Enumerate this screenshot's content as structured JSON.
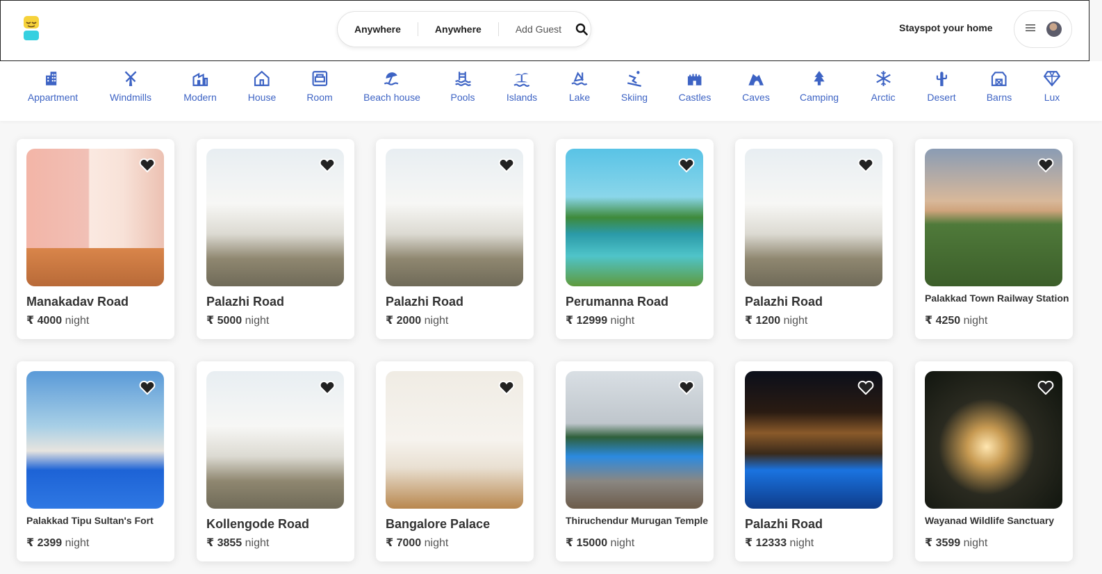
{
  "header": {
    "search": {
      "location": "Anywhere",
      "dates": "Anywhere",
      "guests": "Add Guest"
    },
    "host_link": "Stayspot your home"
  },
  "categories": [
    {
      "label": "Appartment",
      "icon": "apartment-icon"
    },
    {
      "label": "Windmills",
      "icon": "windmill-icon"
    },
    {
      "label": "Modern",
      "icon": "modern-icon"
    },
    {
      "label": "House",
      "icon": "house-icon"
    },
    {
      "label": "Room",
      "icon": "room-icon"
    },
    {
      "label": "Beach house",
      "icon": "beach-icon"
    },
    {
      "label": "Pools",
      "icon": "pool-icon"
    },
    {
      "label": "Islands",
      "icon": "island-icon"
    },
    {
      "label": "Lake",
      "icon": "lake-icon"
    },
    {
      "label": "Skiing",
      "icon": "skiing-icon"
    },
    {
      "label": "Castles",
      "icon": "castle-icon"
    },
    {
      "label": "Caves",
      "icon": "cave-icon"
    },
    {
      "label": "Camping",
      "icon": "camping-icon"
    },
    {
      "label": "Arctic",
      "icon": "snowflake-icon"
    },
    {
      "label": "Desert",
      "icon": "cactus-icon"
    },
    {
      "label": "Barns",
      "icon": "barn-icon"
    },
    {
      "label": "Lux",
      "icon": "diamond-icon"
    }
  ],
  "listings": [
    {
      "title": "Manakadav Road",
      "currency": "₹",
      "price": "4000",
      "unit": "night"
    },
    {
      "title": "Palazhi Road",
      "currency": "₹",
      "price": "5000",
      "unit": "night"
    },
    {
      "title": "Palazhi Road",
      "currency": "₹",
      "price": "2000",
      "unit": "night"
    },
    {
      "title": "Perumanna Road",
      "currency": "₹",
      "price": "12999",
      "unit": "night"
    },
    {
      "title": "Palazhi Road",
      "currency": "₹",
      "price": "1200",
      "unit": "night"
    },
    {
      "title": "Palakkad Town Railway Station",
      "currency": "₹",
      "price": "4250",
      "unit": "night"
    },
    {
      "title": "Palakkad Tipu Sultan's Fort",
      "currency": "₹",
      "price": "2399",
      "unit": "night"
    },
    {
      "title": "Kollengode Road",
      "currency": "₹",
      "price": "3855",
      "unit": "night"
    },
    {
      "title": "Bangalore Palace",
      "currency": "₹",
      "price": "7000",
      "unit": "night"
    },
    {
      "title": "Thiruchendur Murugan Temple",
      "currency": "₹",
      "price": "15000",
      "unit": "night"
    },
    {
      "title": "Palazhi Road",
      "currency": "₹",
      "price": "12333",
      "unit": "night"
    },
    {
      "title": "Wayanad Wildlife Sanctuary",
      "currency": "₹",
      "price": "3599",
      "unit": "night"
    }
  ],
  "colors": {
    "accent": "#3d63c4",
    "text": "#222222"
  }
}
